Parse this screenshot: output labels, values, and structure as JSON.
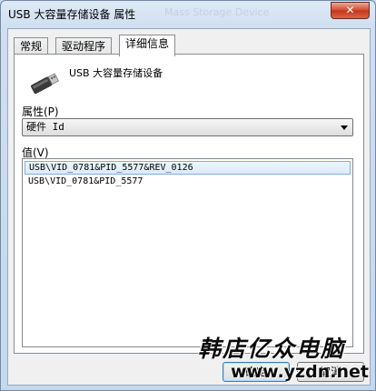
{
  "window": {
    "title": "USB 大容量存储设备 属性",
    "title_shadow": "Mass Storage Device",
    "close_glyph": "✕"
  },
  "tabs": [
    {
      "label": "常规",
      "active": false
    },
    {
      "label": "驱动程序",
      "active": false
    },
    {
      "label": "详细信息",
      "active": true
    }
  ],
  "device": {
    "name": "USB 大容量存储设备",
    "icon": "usb-drive-icon"
  },
  "property": {
    "label": "属性(P)",
    "selected": "硬件 Id"
  },
  "value": {
    "label": "值(V)",
    "items": [
      {
        "text": "USB\\VID_0781&PID_5577&REV_0126",
        "selected": true
      },
      {
        "text": "USB\\VID_0781&PID_5577",
        "selected": false
      }
    ]
  },
  "buttons": {
    "ok": "确定",
    "cancel": "取消"
  },
  "watermark": {
    "chinese": "韩店亿众电脑",
    "url": "www.yzdn.net"
  }
}
